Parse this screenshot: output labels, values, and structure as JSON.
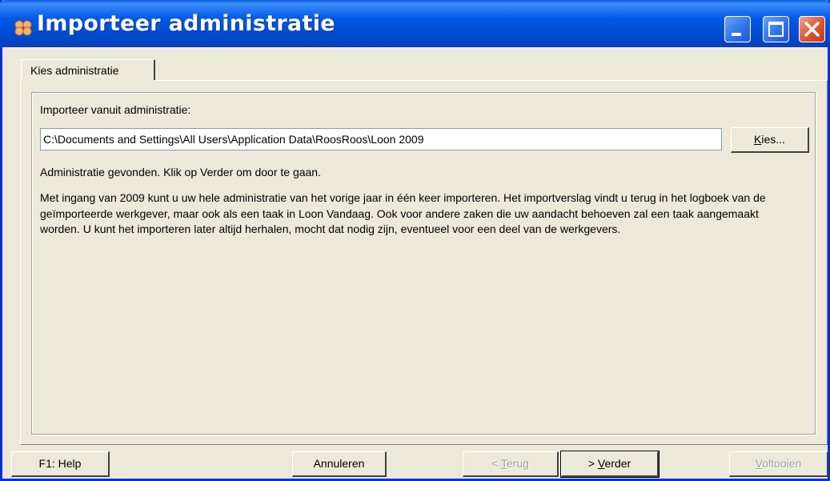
{
  "window": {
    "title": "Importeer administratie",
    "icon": "roosroos-app-icon",
    "controls": {
      "minimize": "minimize-icon",
      "maximize": "maximize-icon",
      "close": "close-icon"
    }
  },
  "tabs": [
    {
      "label": "Kies administratie",
      "active": true
    }
  ],
  "form": {
    "source_label": "Importeer vanuit administratie:",
    "source_path": "C:\\Documents and Settings\\All Users\\Application Data\\RoosRoos\\Loon 2009",
    "choose_button": {
      "mnemonic": "K",
      "rest": "ies..."
    },
    "status": "Administratie gevonden. Klik op Verder om door te gaan.",
    "description": "Met ingang van 2009 kunt u uw hele administratie van het vorige jaar in één keer importeren. Het importverslag vindt u terug in het logboek van de geïmporteerde werkgever, maar ook als een taak in Loon Vandaag. Ook voor andere zaken die uw aandacht behoeven zal een taak aangemaakt worden. U kunt het importeren later altijd herhalen, mocht dat nodig zijn, eventueel voor een deel van de werkgevers."
  },
  "buttons": {
    "help": "F1: Help",
    "cancel": "Annuleren",
    "back": {
      "prefix": "< ",
      "mnemonic": "T",
      "rest": "erug",
      "enabled": false
    },
    "next": {
      "prefix": "> ",
      "mnemonic": "V",
      "rest": "erder",
      "enabled": true
    },
    "finish": {
      "prefix": "",
      "mnemonic": "V",
      "rest": "oltooien",
      "enabled": false
    }
  },
  "colors": {
    "titlebar": "#0058e6",
    "face": "#ece9d8",
    "close": "#e0542d",
    "disabled_text": "#a0a0a0"
  }
}
